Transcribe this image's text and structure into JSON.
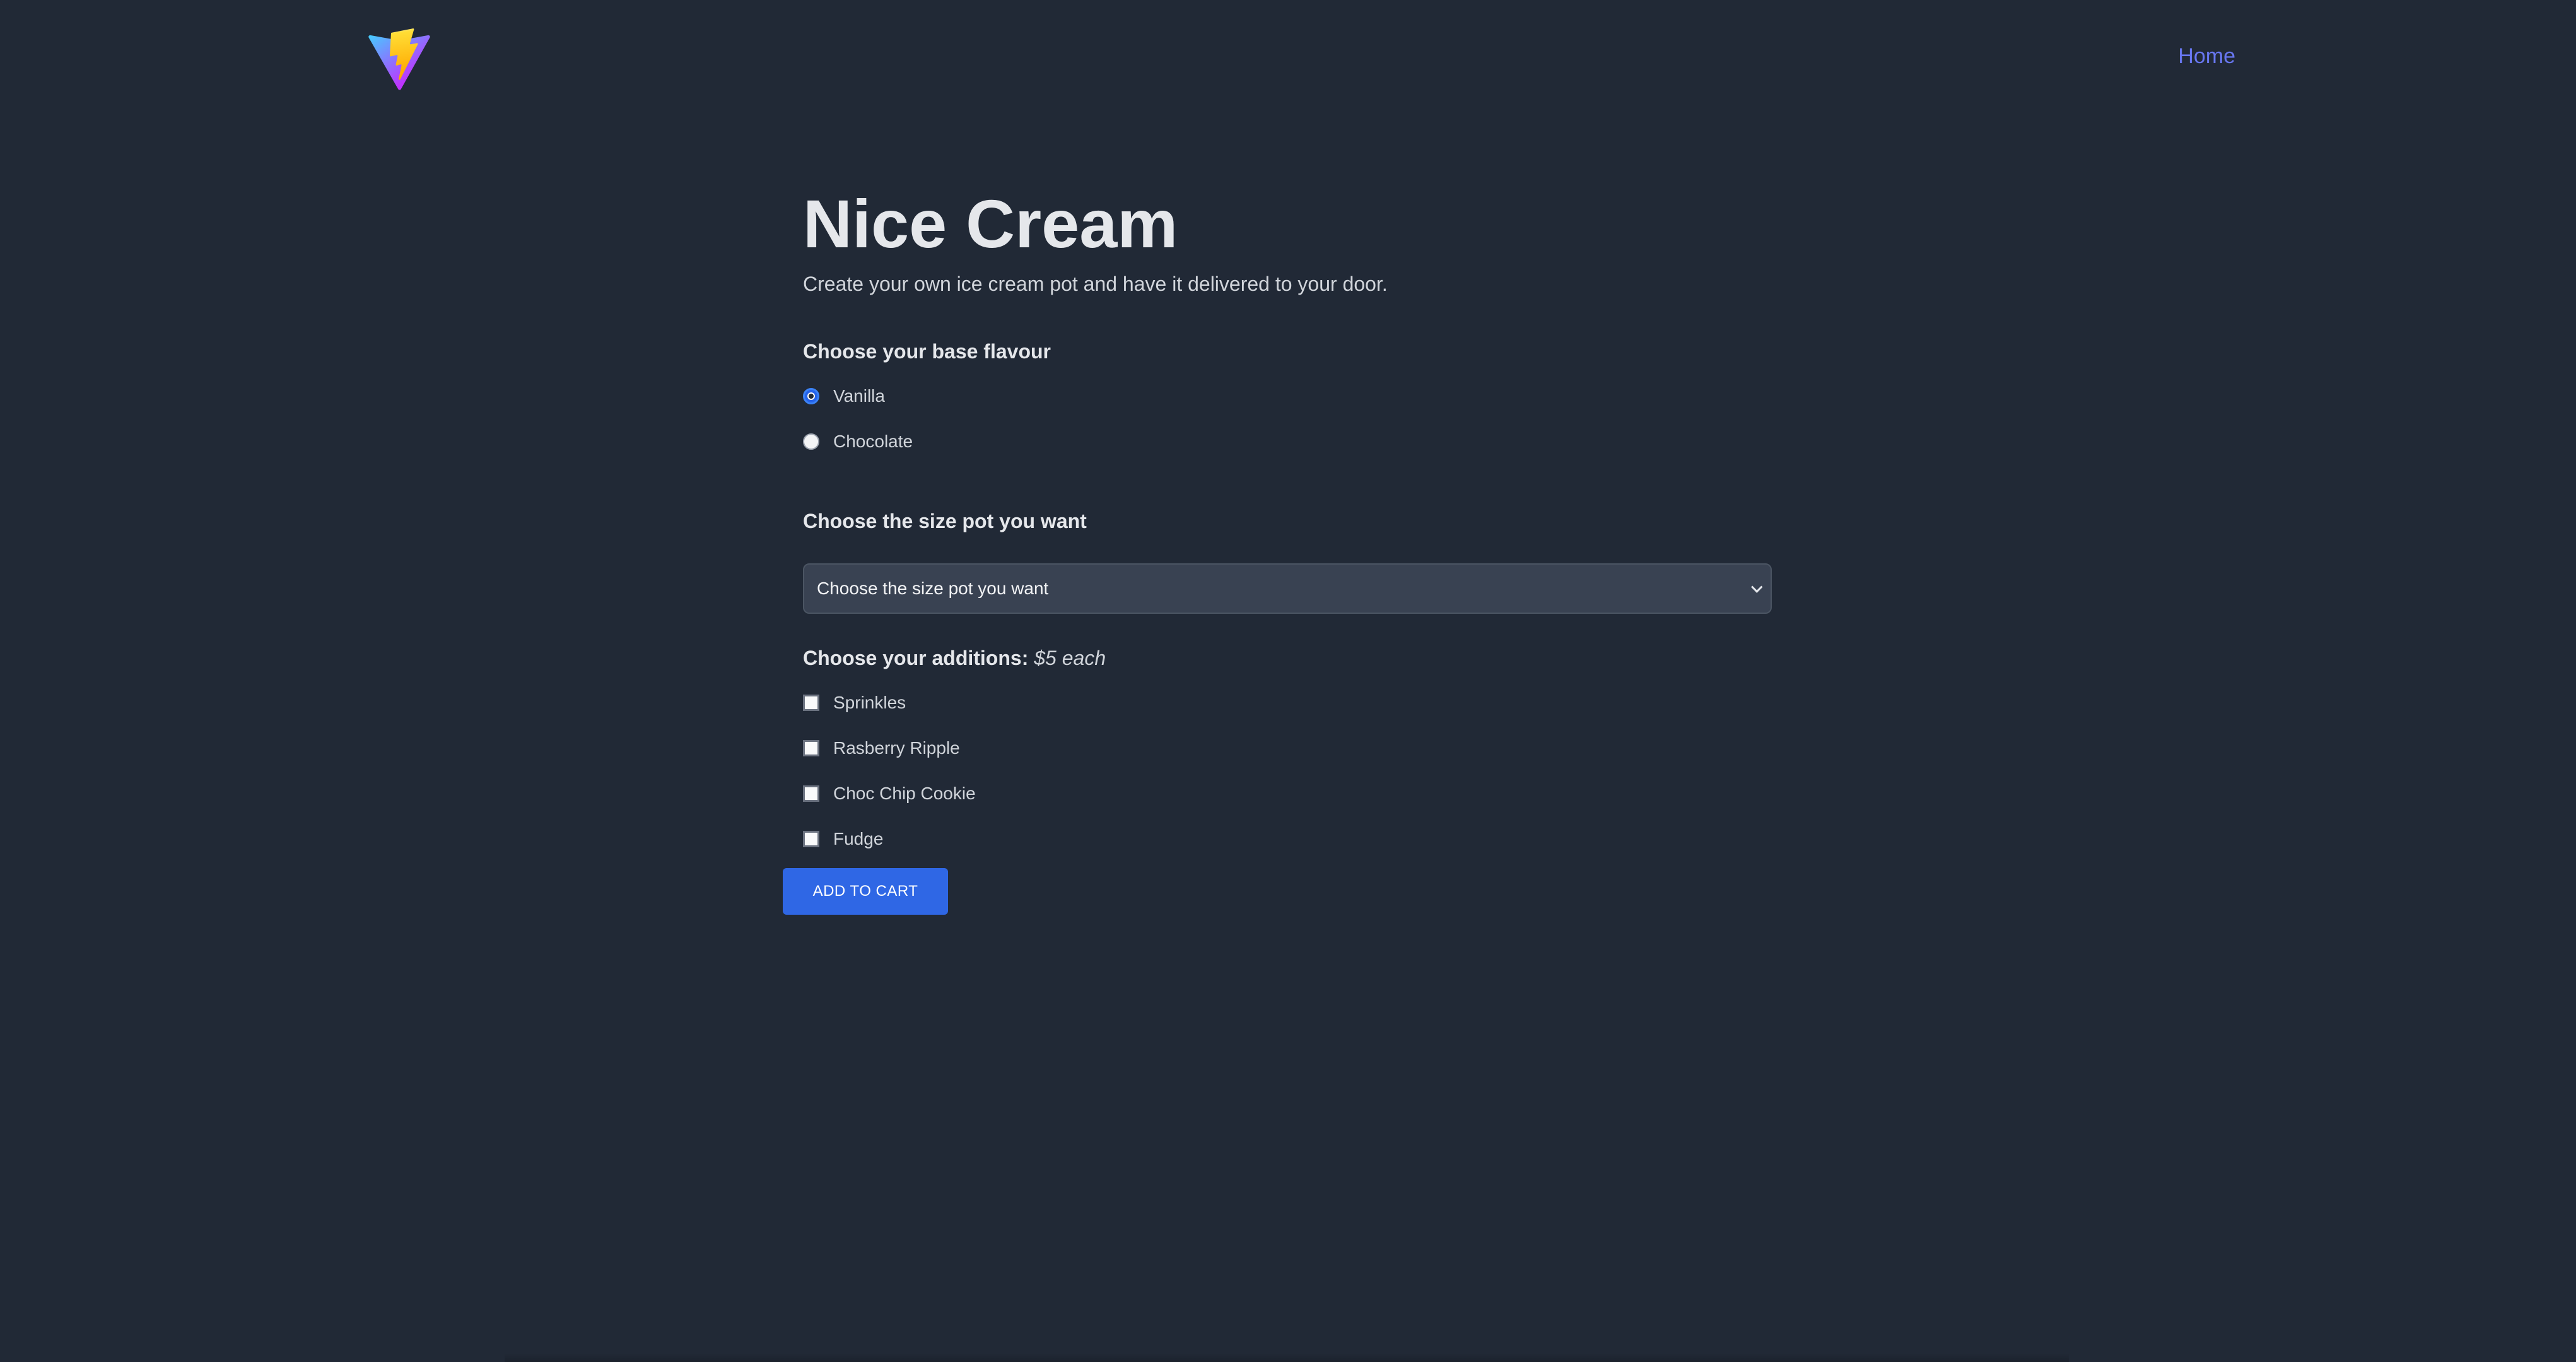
{
  "header": {
    "logo_icon": "vite-logo-icon",
    "nav_home_label": "Home"
  },
  "main": {
    "title": "Nice Cream",
    "subtitle": "Create your own ice cream pot and have it delivered to your door.",
    "flavour": {
      "heading": "Choose your base flavour",
      "options": [
        {
          "label": "Vanilla",
          "checked": true
        },
        {
          "label": "Chocolate",
          "checked": false
        }
      ]
    },
    "size": {
      "heading": "Choose the size pot you want",
      "select_value": "Choose the size pot you want"
    },
    "additions": {
      "heading": "Choose your additions:",
      "price_note": "$5 each",
      "items": [
        {
          "label": "Sprinkles",
          "checked": false
        },
        {
          "label": "Rasberry Ripple",
          "checked": false
        },
        {
          "label": "Choc Chip Cookie",
          "checked": false
        },
        {
          "label": "Fudge",
          "checked": false
        }
      ]
    },
    "add_to_cart_label": "ADD TO CART"
  },
  "colors": {
    "background": "#212936",
    "accent": "#2f67e5",
    "link": "#6877f0",
    "select_bg": "#394252"
  }
}
